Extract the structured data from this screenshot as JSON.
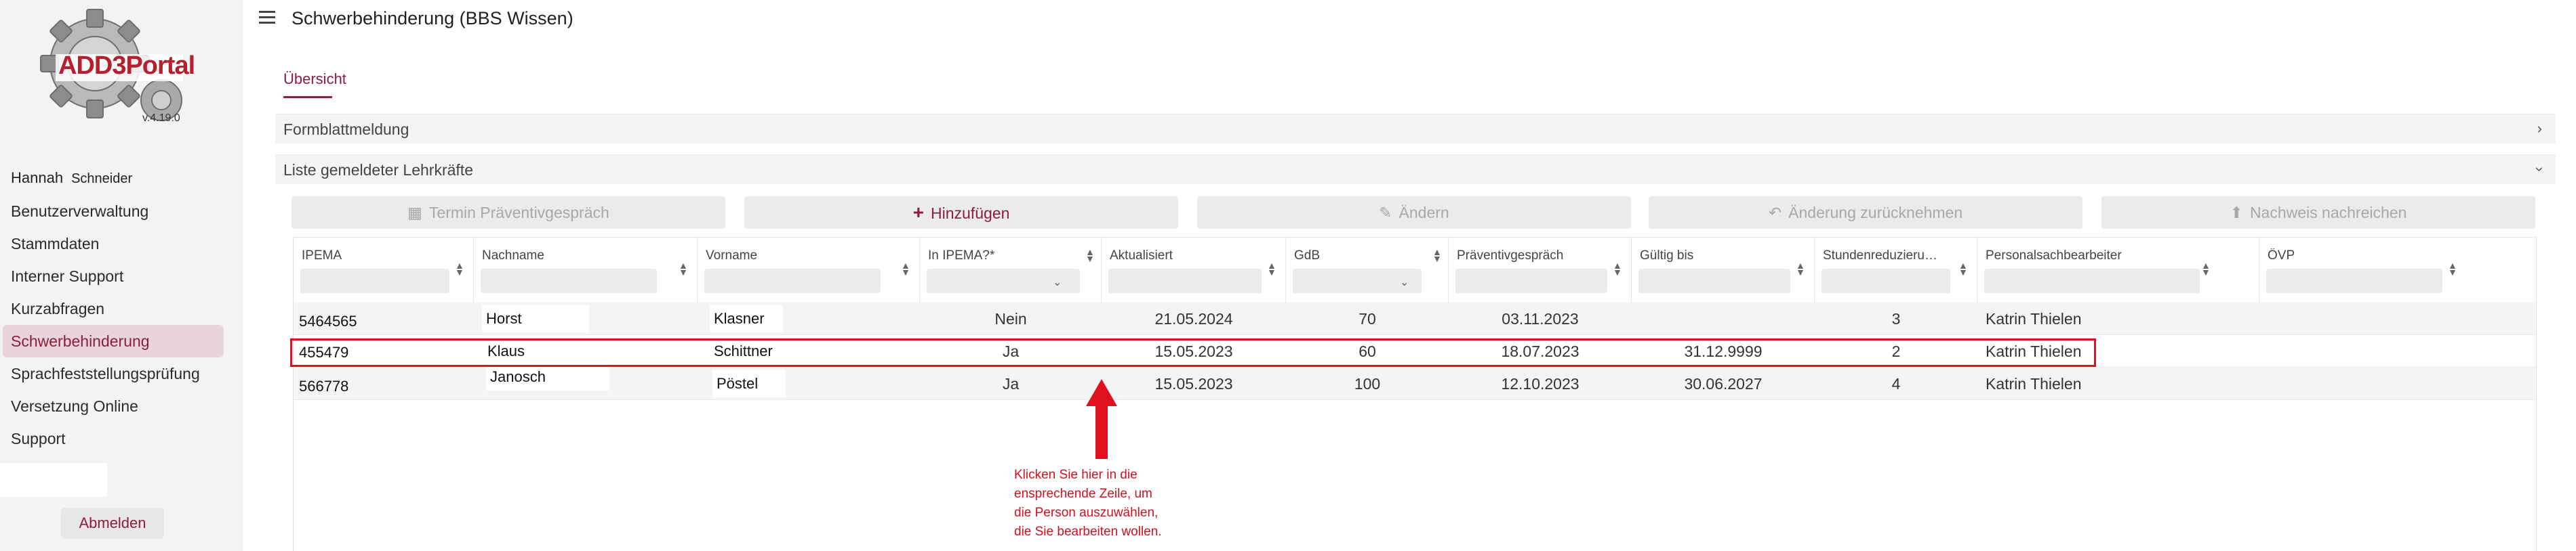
{
  "logo": {
    "text": "ADD3Portal",
    "version": "v.4.19.0"
  },
  "user": {
    "first_name": "Hannah",
    "last_name": "Schneider"
  },
  "nav": [
    {
      "label": "Benutzerverwaltung",
      "active": false
    },
    {
      "label": "Stammdaten",
      "active": false
    },
    {
      "label": "Interner Support",
      "active": false
    },
    {
      "label": "Kurzabfragen",
      "active": false
    },
    {
      "label": "Schwerbehinderung",
      "active": true
    },
    {
      "label": "Sprachfeststellungsprüfung",
      "active": false
    },
    {
      "label": "Versetzung Online",
      "active": false
    },
    {
      "label": "Support",
      "active": false
    }
  ],
  "logout_label": "Abmelden",
  "header": {
    "title": "Schwerbehinderung (BBS Wissen)"
  },
  "tabs": [
    {
      "label": "Übersicht",
      "active": true
    }
  ],
  "sections": {
    "formblatt": "Formblattmeldung",
    "liste": "Liste gemeldeter Lehrkräfte"
  },
  "toolbar": {
    "termin": "Termin Präventivgespräch",
    "hinzufuegen": "Hinzufügen",
    "aendern": "Ändern",
    "zuruecknehmen": "Änderung zurücknehmen",
    "nachweis": "Nachweis nachreichen"
  },
  "table": {
    "columns": [
      "IPEMA",
      "Nachname",
      "Vorname",
      "In IPEMA?*",
      "Aktualisiert",
      "GdB",
      "Präventivgespräch",
      "Gültig bis",
      "Stundenreduzieru…",
      "Personalsachbearbeiter",
      "ÖVP"
    ],
    "rows": [
      {
        "ipema": "5464565",
        "nachname": "Horst",
        "vorname": "Klasner",
        "in_ipema": "Nein",
        "aktualisiert": "21.05.2024",
        "gdb": "70",
        "praeventiv": "03.11.2023",
        "gueltig": "",
        "stunden": "3",
        "sachbearbeiter": "Katrin Thielen",
        "oevp": ""
      },
      {
        "ipema": "455479",
        "nachname": "Klaus",
        "vorname": "Schittner",
        "in_ipema": "Ja",
        "aktualisiert": "15.05.2023",
        "gdb": "60",
        "praeventiv": "18.07.2023",
        "gueltig": "31.12.9999",
        "stunden": "2",
        "sachbearbeiter": "Katrin Thielen",
        "oevp": ""
      },
      {
        "ipema": "566778",
        "nachname": "Janosch",
        "vorname": "Pöstel",
        "in_ipema": "Ja",
        "aktualisiert": "15.05.2023",
        "gdb": "100",
        "praeventiv": "12.10.2023",
        "gueltig": "30.06.2027",
        "stunden": "4",
        "sachbearbeiter": "Katrin Thielen",
        "oevp": ""
      }
    ]
  },
  "annotation": {
    "text": "Klicken Sie hier in die\nensprechende Zeile, um\ndie Person auszuwählen,\ndie Sie bearbeiten wollen.",
    "color": "#d2101e"
  },
  "colors": {
    "accent": "#8a1f3d",
    "highlight": "#e0101e"
  }
}
